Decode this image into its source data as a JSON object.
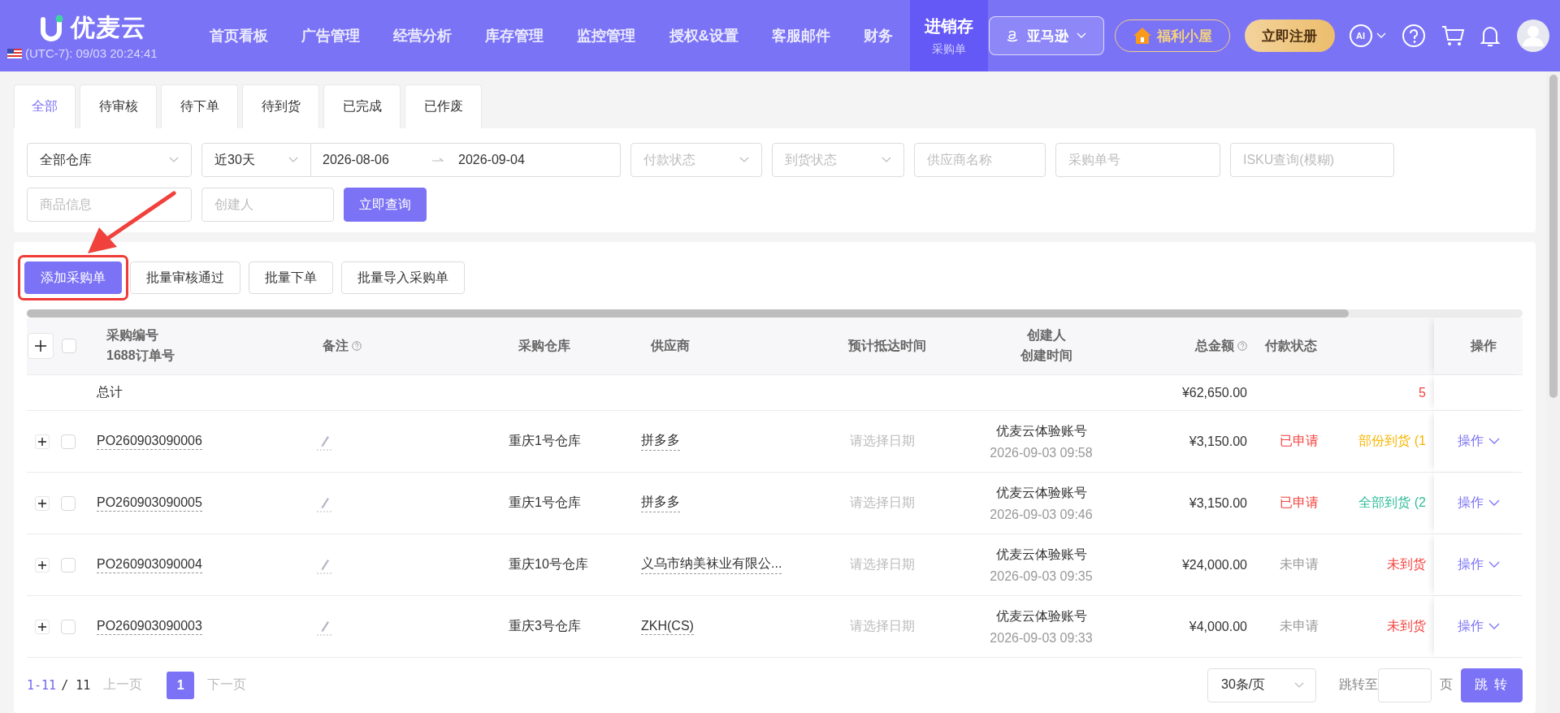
{
  "header": {
    "logo": "优麦云",
    "clock": "(UTC-7): 09/03 20:24:41",
    "nav": [
      {
        "label": "首页看板",
        "selected": false
      },
      {
        "label": "广告管理",
        "selected": false
      },
      {
        "label": "经营分析",
        "selected": false
      },
      {
        "label": "库存管理",
        "selected": false
      },
      {
        "label": "监控管理",
        "selected": false
      },
      {
        "label": "授权&设置",
        "selected": false
      },
      {
        "label": "客服邮件",
        "selected": false
      },
      {
        "label": "财务",
        "selected": false
      },
      {
        "label": "进销存",
        "sublabel": "采购单",
        "selected": true
      }
    ],
    "marketplace": "亚马逊",
    "assistant": "AI",
    "welfare": "福利小屋",
    "register": "立即注册"
  },
  "tabs": [
    {
      "label": "全部",
      "selected": true
    },
    {
      "label": "待审核",
      "selected": false
    },
    {
      "label": "待下单",
      "selected": false
    },
    {
      "label": "待到货",
      "selected": false
    },
    {
      "label": "已完成",
      "selected": false
    },
    {
      "label": "已作废",
      "selected": false
    }
  ],
  "filter_rows": [
    [
      {
        "kind": "select",
        "value": "全部仓库"
      },
      {
        "kind": "daterange",
        "value": "近30天",
        "start": "2026-08-06",
        "end": "2026-09-04"
      },
      {
        "kind": "select",
        "placeholder": "付款状态"
      },
      {
        "kind": "select",
        "placeholder": "到货状态"
      },
      {
        "kind": "input",
        "placeholder": "供应商名称"
      },
      {
        "kind": "input",
        "placeholder": "采购单号"
      },
      {
        "kind": "input",
        "placeholder": "ISKU查询(模糊)"
      }
    ],
    [
      {
        "kind": "input",
        "placeholder": "商品信息"
      },
      {
        "kind": "input",
        "placeholder": "创建人"
      },
      {
        "kind": "button",
        "label": "立即查询"
      }
    ]
  ],
  "actions": [
    {
      "label": "添加采购单",
      "primary": true,
      "highlighted": true
    },
    {
      "label": "批量审核通过",
      "primary": false,
      "highlighted": false
    },
    {
      "label": "批量下单",
      "primary": false,
      "highlighted": false
    },
    {
      "label": "批量导入采购单",
      "primary": false,
      "highlighted": false
    }
  ],
  "table": {
    "all_checked": false,
    "columns": [
      {
        "label": "采购编号",
        "sublabel": "1688订单号"
      },
      {
        "label": "备注",
        "help": true
      },
      {
        "label": "采购仓库"
      },
      {
        "label": "供应商"
      },
      {
        "label": "预计抵达时间"
      },
      {
        "label": "创建人",
        "sublabel": "创建时间"
      },
      {
        "label": "总金额",
        "help": true
      },
      {
        "label": "付款状态"
      },
      {
        "label": "操作"
      }
    ],
    "total": {
      "label": "总计",
      "amount": "¥62,650.00",
      "arrival": "5"
    },
    "rows": [
      {
        "checked": false,
        "po": "PO260903090006",
        "warehouse": "重庆1号仓库",
        "supplier": "拼多多",
        "eta": "请选择日期",
        "creator": "优麦云体验账号",
        "created": "2026-09-03 09:58",
        "amount": "¥3,150.00",
        "pay": {
          "text": "已申请",
          "color": "#f4433f"
        },
        "arrival": {
          "text": "部份到货 (1",
          "color": "#f7b500"
        },
        "action": "操作"
      },
      {
        "checked": false,
        "po": "PO260903090005",
        "warehouse": "重庆1号仓库",
        "supplier": "拼多多",
        "eta": "请选择日期",
        "creator": "优麦云体验账号",
        "created": "2026-09-03 09:46",
        "amount": "¥3,150.00",
        "pay": {
          "text": "已申请",
          "color": "#f4433f"
        },
        "arrival": {
          "text": "全部到货 (2",
          "color": "#2dbd96"
        },
        "action": "操作"
      },
      {
        "checked": false,
        "po": "PO260903090004",
        "warehouse": "重庆10号仓库",
        "supplier": "义乌市纳美袜业有限公...",
        "eta": "请选择日期",
        "creator": "优麦云体验账号",
        "created": "2026-09-03 09:35",
        "amount": "¥24,000.00",
        "pay": {
          "text": "未申请",
          "color": "#999999"
        },
        "arrival": {
          "text": "未到货",
          "color": "#f4433f"
        },
        "action": "操作"
      },
      {
        "checked": false,
        "po": "PO260903090003",
        "warehouse": "重庆3号仓库",
        "supplier": "ZKH(CS)",
        "eta": "请选择日期",
        "creator": "优麦云体验账号",
        "created": "2026-09-03 09:33",
        "amount": "¥4,000.00",
        "pay": {
          "text": "未申请",
          "color": "#999999"
        },
        "arrival": {
          "text": "未到货",
          "color": "#f4433f"
        },
        "action": "操作"
      }
    ]
  },
  "pagination": {
    "range": "1-11",
    "count": "/ 11",
    "prev": "上一页",
    "pages": [
      {
        "label": "1",
        "selected": true
      }
    ],
    "next": "下一页",
    "page_size": "30条/页",
    "jump_label": "跳转至",
    "unit": "页",
    "jump_button": "跳 转"
  }
}
